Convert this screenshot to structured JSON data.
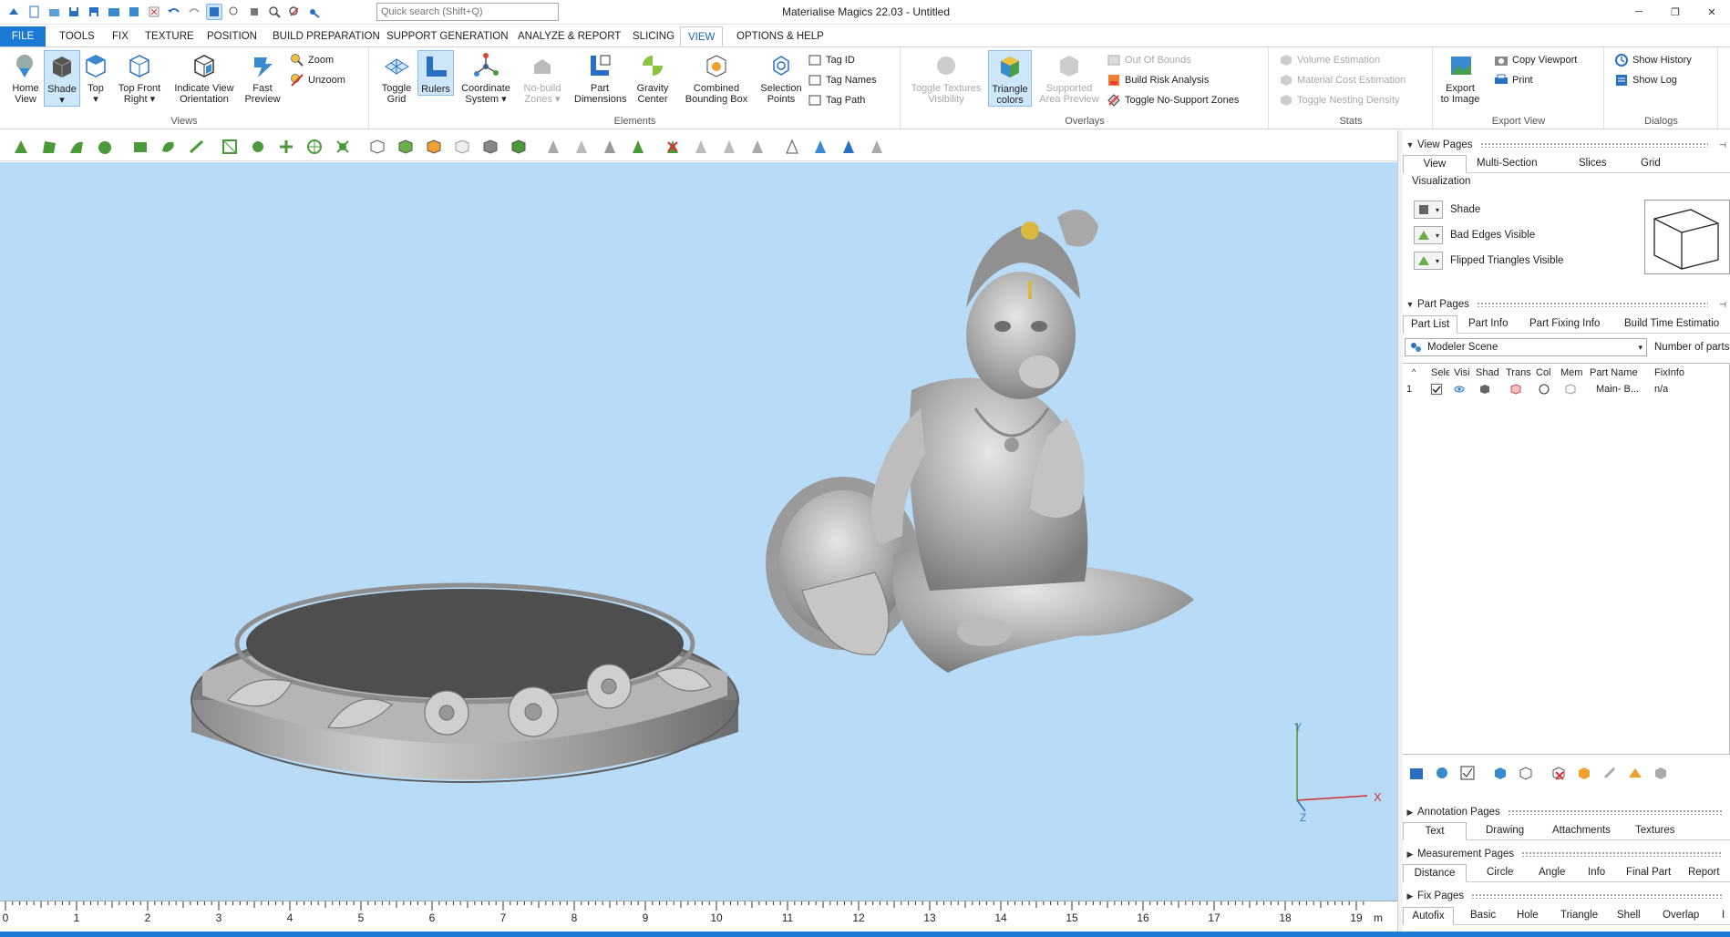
{
  "window": {
    "title": "Materialise Magics 22.03 - Untitled",
    "search_placeholder": "Quick search (Shift+Q)",
    "controls": [
      "─",
      "❐",
      "✕"
    ]
  },
  "menu_tabs": [
    "FILE",
    "TOOLS",
    "FIX",
    "TEXTURE",
    "POSITION",
    "BUILD PREPARATION",
    "SUPPORT GENERATION",
    "ANALYZE & REPORT",
    "SLICING",
    "VIEW",
    "OPTIONS & HELP"
  ],
  "active_tab": "VIEW",
  "ribbon": {
    "views": {
      "group": "Views",
      "home": [
        "Home",
        "View"
      ],
      "shade": [
        "Shade",
        "▾"
      ],
      "top": [
        "Top",
        "▾"
      ],
      "top_front_right": [
        "Top Front",
        "Right ▾"
      ],
      "indicate": [
        "Indicate View",
        "Orientation"
      ],
      "fast": [
        "Fast",
        "Preview"
      ],
      "zoom": "Zoom",
      "unzoom": "Unzoom"
    },
    "elements": {
      "group": "Elements",
      "toggle_grid": [
        "Toggle",
        "Grid"
      ],
      "rulers": [
        "Rulers",
        ""
      ],
      "coordinate": [
        "Coordinate",
        "System ▾"
      ],
      "nobuild": [
        "No-build",
        "Zones ▾"
      ],
      "part_dim": [
        "Part",
        "Dimensions"
      ],
      "gravity": [
        "Gravity",
        "Center"
      ],
      "combined": [
        "Combined",
        "Bounding Box"
      ],
      "selection": [
        "Selection",
        "Points"
      ],
      "tag_id": "Tag ID",
      "tag_names": "Tag Names",
      "tag_path": "Tag Path"
    },
    "overlays": {
      "group": "Overlays",
      "toggle_tex": [
        "Toggle Textures",
        "Visibility"
      ],
      "triangle": [
        "Triangle",
        "colors"
      ],
      "supported": [
        "Supported",
        "Area Preview"
      ],
      "out_of_bounds": "Out Of Bounds",
      "build_risk": "Build Risk Analysis",
      "no_support": "Toggle No-Support Zones"
    },
    "stats": {
      "group": "Stats",
      "volume": "Volume Estimation",
      "material": "Material Cost Estimation",
      "nesting": "Toggle Nesting Density"
    },
    "export": {
      "group": "Export View",
      "export_image": [
        "Export",
        "to Image"
      ],
      "copy_viewport": "Copy Viewport",
      "print": "Print"
    },
    "dialogs": {
      "group": "Dialogs",
      "history": "Show History",
      "log": "Show Log"
    }
  },
  "ruler": {
    "ticks": [
      "0",
      "1",
      "2",
      "3",
      "4",
      "5",
      "6",
      "7",
      "8",
      "9",
      "10",
      "11",
      "12",
      "13",
      "14",
      "15",
      "16",
      "17",
      "18",
      "19"
    ],
    "unit": "m"
  },
  "axis": {
    "y": "Y",
    "x": "X",
    "z": "Z"
  },
  "panel": {
    "view_pages": {
      "title": "View Pages",
      "tabs": [
        "View",
        "Multi-Section",
        "Slices",
        "Grid"
      ],
      "section": "Visualization",
      "rows": [
        "Shade",
        "Bad Edges Visible",
        "Flipped Triangles Visible"
      ]
    },
    "part_pages": {
      "title": "Part Pages",
      "tabs": [
        "Part List",
        "Part Info",
        "Part Fixing Info",
        "Build Time Estimatio"
      ],
      "scene": "Modeler Scene",
      "num_parts": "Number of parts",
      "columns": [
        "Sele",
        "Visi",
        "Shad",
        "Trans",
        "Col",
        "Mem",
        "Part Name",
        "FixInfo"
      ],
      "rows": [
        {
          "index": "1",
          "name": "Main- B...",
          "fixinfo": "n/a"
        }
      ]
    },
    "annotation_pages": {
      "title": "Annotation Pages",
      "tabs": [
        "Text",
        "Drawing",
        "Attachments",
        "Textures"
      ]
    },
    "measurement_pages": {
      "title": "Measurement Pages",
      "tabs": [
        "Distance",
        "Circle",
        "Angle",
        "Info",
        "Final Part",
        "Report"
      ]
    },
    "fix_pages": {
      "title": "Fix Pages",
      "tabs": [
        "Autofix",
        "Basic",
        "Hole",
        "Triangle",
        "Shell",
        "Overlap",
        "I"
      ]
    }
  },
  "colors": {
    "accent": "#1b7bd4",
    "viewport": "#b8dcf7",
    "selected": "#cde6f8"
  }
}
